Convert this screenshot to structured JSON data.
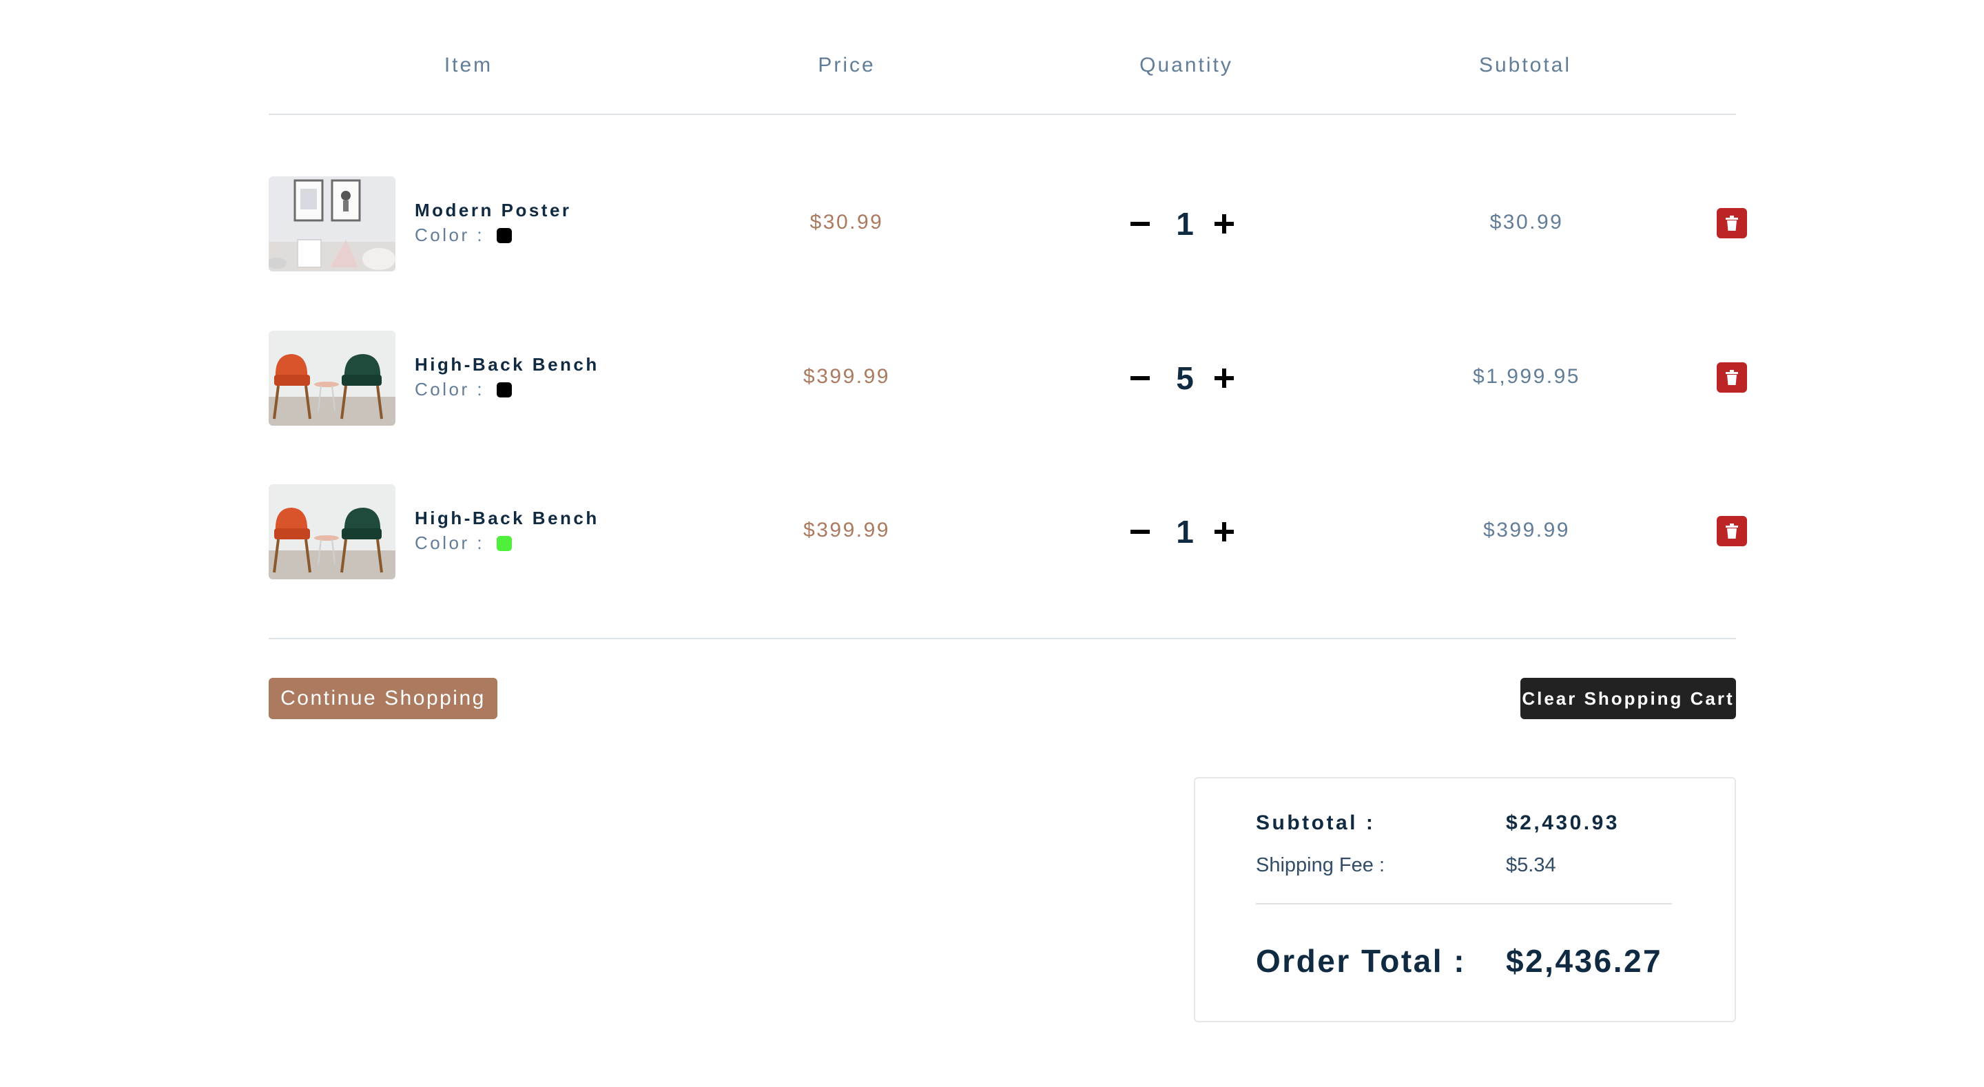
{
  "header": {
    "item": "Item",
    "price": "Price",
    "quantity": "Quantity",
    "subtotal": "Subtotal"
  },
  "items": [
    {
      "name": "Modern Poster",
      "color_label": "Color :",
      "color": "#000000",
      "price": "$30.99",
      "quantity": "1",
      "subtotal": "$30.99",
      "image": "poster-photo"
    },
    {
      "name": "High-Back Bench",
      "color_label": "Color :",
      "color": "#000000",
      "price": "$399.99",
      "quantity": "5",
      "subtotal": "$1,999.95",
      "image": "chairs-photo"
    },
    {
      "name": "High-Back Bench",
      "color_label": "Color :",
      "color": "#4ff03b",
      "price": "$399.99",
      "quantity": "1",
      "subtotal": "$399.99",
      "image": "chairs-photo"
    }
  ],
  "icons": {
    "decrease": "minus-icon",
    "increase": "plus-icon",
    "remove": "trash-icon"
  },
  "actions": {
    "continue_shopping": "Continue Shopping",
    "clear_cart": "Clear Shopping Cart"
  },
  "totals": {
    "subtotal_label": "Subtotal :",
    "subtotal_value": "$2,430.93",
    "shipping_label": "Shipping Fee :",
    "shipping_value": "$5.34",
    "order_total_label": "Order Total :",
    "order_total_value": "$2,436.27"
  },
  "colors": {
    "accent": "#ab7a5f",
    "danger": "#bb2525",
    "dark": "#222222",
    "heading": "#102a42",
    "muted": "#617d98"
  }
}
